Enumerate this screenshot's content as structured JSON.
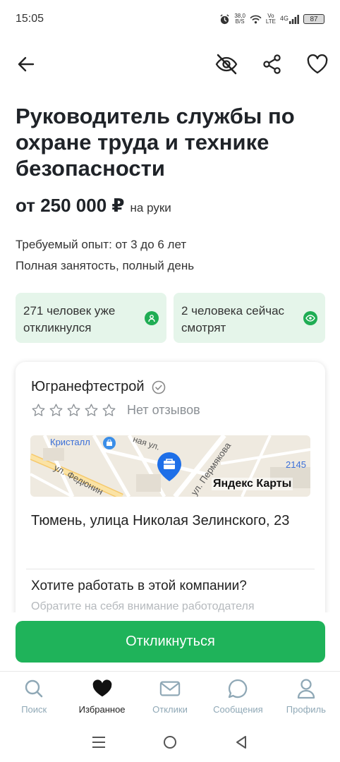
{
  "status_bar": {
    "time": "15:05",
    "speed_value": "38,0",
    "speed_unit": "B/S",
    "volte_top": "Vo",
    "volte_bottom": "LTE",
    "network": "4G",
    "battery": "87"
  },
  "vacancy": {
    "title": "Руководитель службы по охране труда и технике безопасности",
    "salary": "от 250 000 ₽",
    "salary_note": "на руки",
    "experience": "Требуемый опыт: от 3 до 6 лет",
    "employment": "Полная занятость, полный день"
  },
  "stats": {
    "responded": "271 человек уже откликнулся",
    "watching": "2 человека сейчас смотрят"
  },
  "company": {
    "name": "Югранефтестрой",
    "reviews": "Нет отзывов",
    "stars_filled": 0,
    "stars_total": 5,
    "address": "Тюмень, улица Николая Зелинского, 23",
    "cta_title": "Хотите работать в этой компании?",
    "cta_subtitle": "Обратите на себя внимание работодателя"
  },
  "map": {
    "label_store": "Кристалл",
    "street_1": "ная ул.",
    "street_2": "ул. Федюнин",
    "street_3": "ул. Пермякова",
    "number": "2145",
    "brand": "Яндекс Карты"
  },
  "apply_label": "Откликнуться",
  "tabs": [
    {
      "label": "Поиск",
      "icon": "search-icon"
    },
    {
      "label": "Избранное",
      "icon": "heart-icon"
    },
    {
      "label": "Отклики",
      "icon": "mail-icon"
    },
    {
      "label": "Сообщения",
      "icon": "chat-icon"
    },
    {
      "label": "Профиль",
      "icon": "user-icon"
    }
  ],
  "active_tab": "Избранное",
  "colors": {
    "accent": "#1fb35a",
    "stat_bg": "#e5f5ea",
    "tab_inactive": "#8fa8b6"
  }
}
